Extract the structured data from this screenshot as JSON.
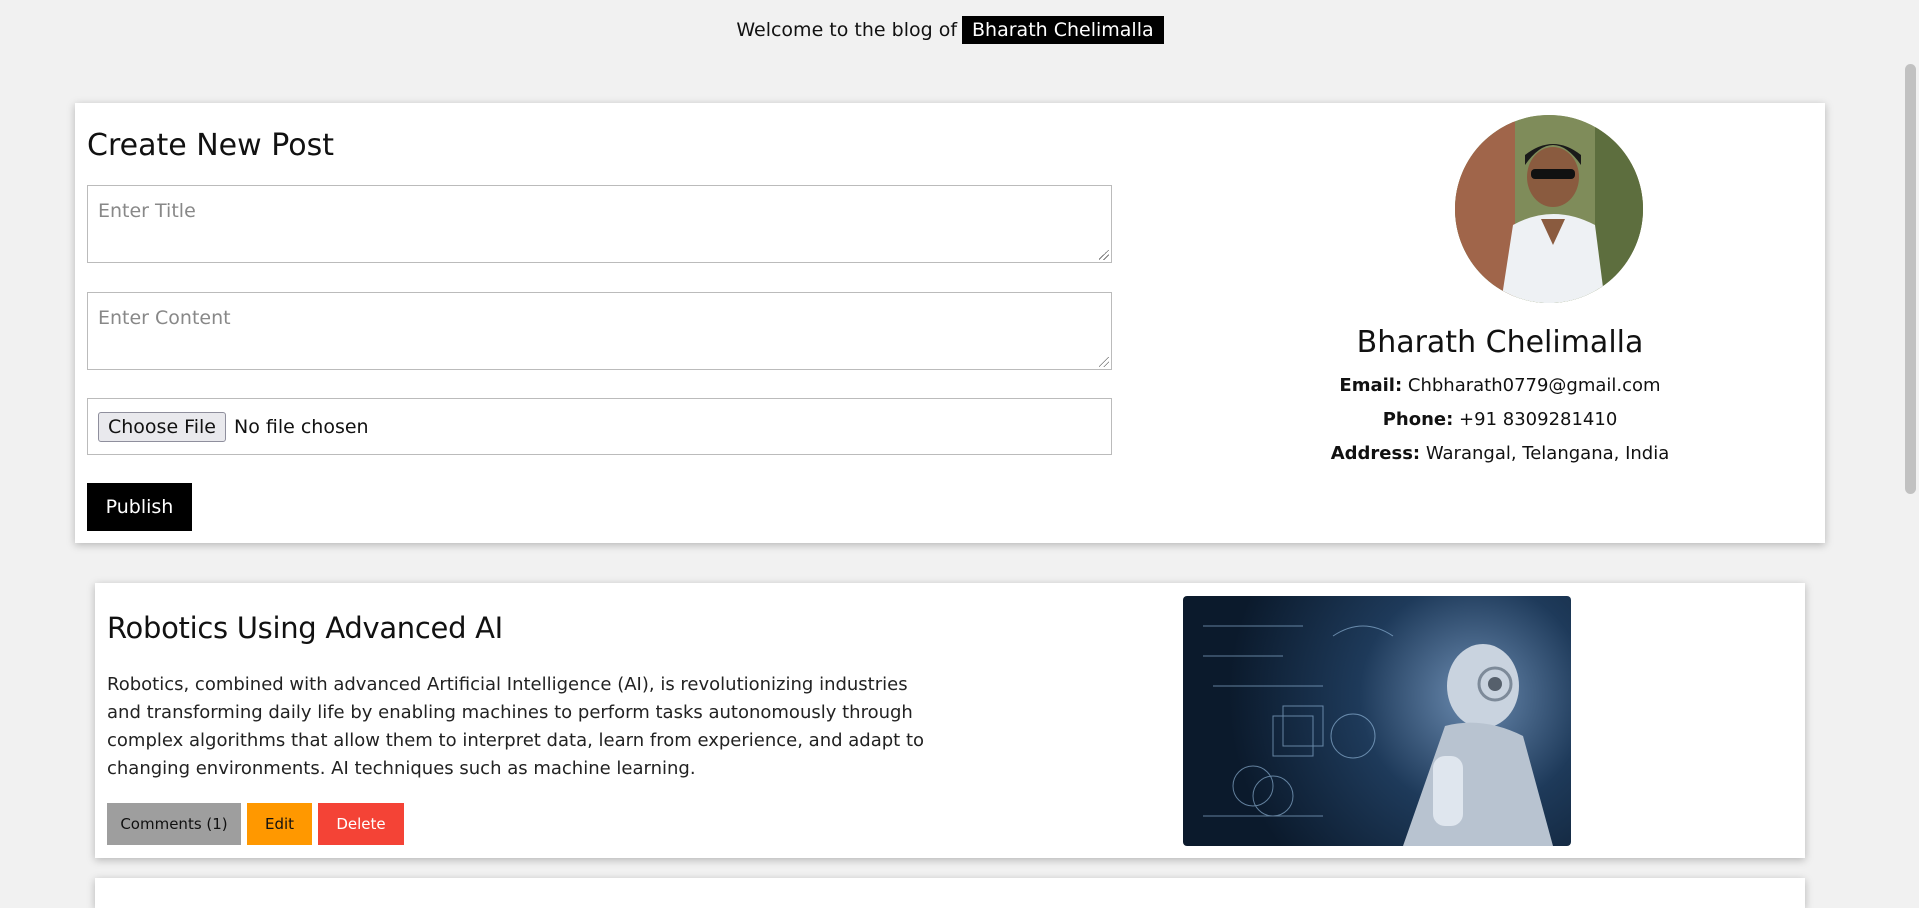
{
  "header": {
    "welcome_text": "Welcome to the blog of",
    "author_badge": "Bharath Chelimalla"
  },
  "create_post": {
    "heading": "Create New Post",
    "title_placeholder": "Enter Title",
    "content_placeholder": "Enter Content",
    "file_button_label": "Choose File",
    "file_status": "No file chosen",
    "publish_label": "Publish"
  },
  "profile": {
    "name": "Bharath Chelimalla",
    "email_label": "Email:",
    "email": "Chbharath0779@gmail.com",
    "phone_label": "Phone:",
    "phone": "+91 8309281410",
    "address_label": "Address:",
    "address": "Warangal, Telangana, India"
  },
  "posts": [
    {
      "title": "Robotics Using Advanced AI",
      "content": "Robotics, combined with advanced Artificial Intelligence (AI), is revolutionizing industries and transforming daily life by enabling machines to perform tasks autonomously through complex algorithms that allow them to interpret data, learn from experience, and adapt to changing environments. AI techniques such as machine learning.",
      "comments_label": "Comments (1)",
      "edit_label": "Edit",
      "delete_label": "Delete"
    }
  ],
  "colors": {
    "background": "#f1f1f1",
    "publish": "#000000",
    "comments": "#9e9e9e",
    "edit": "#ff9800",
    "delete": "#f44336"
  }
}
